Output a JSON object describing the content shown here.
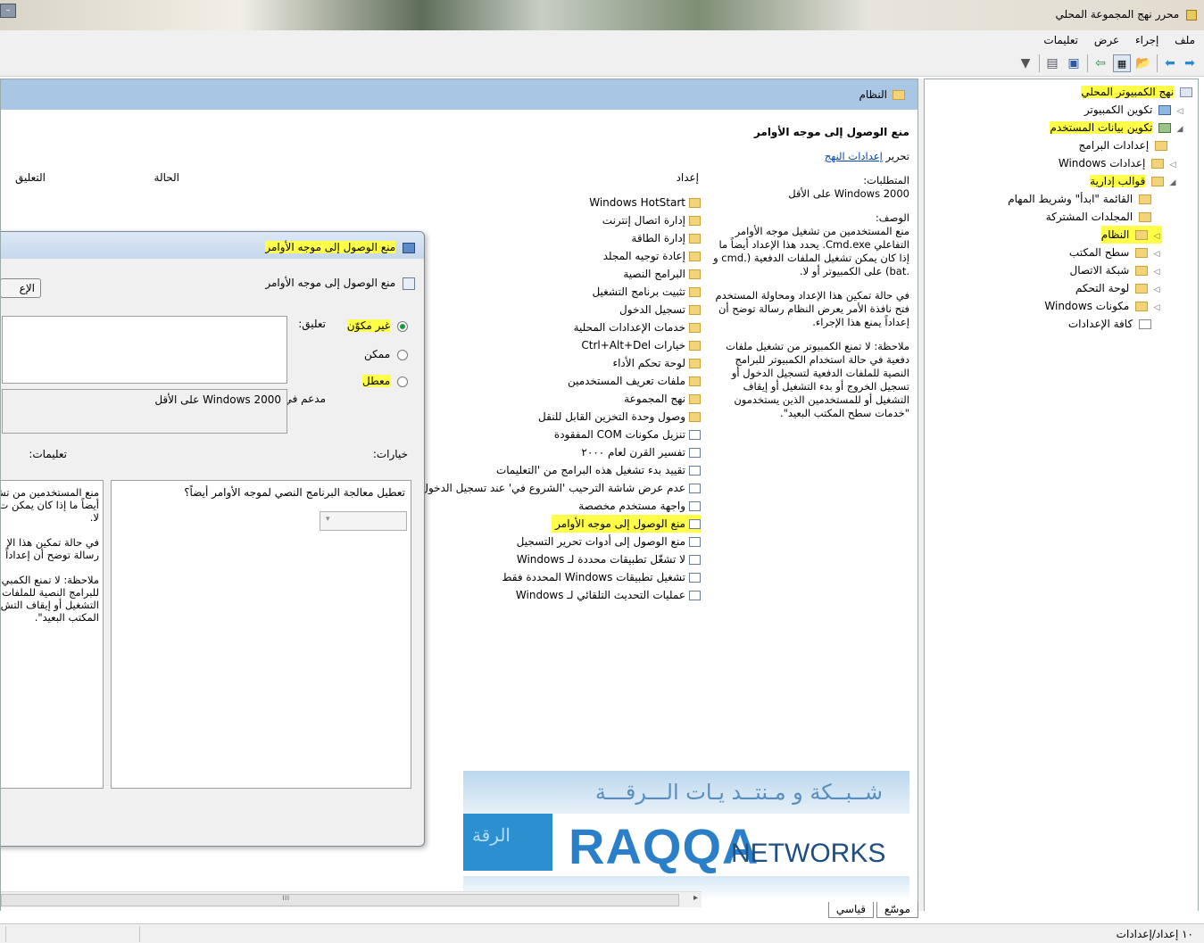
{
  "window": {
    "title": "محرر نهج المجموعة المحلي"
  },
  "menu": [
    "ملف",
    "إجراء",
    "عرض",
    "تعليمات"
  ],
  "tree": [
    {
      "label": "نهج الكمبيوتر المحلي",
      "highlight": true
    },
    {
      "label": "تكوين الكمبيوتر",
      "highlight": false
    },
    {
      "label": "تكوين بيانات المستخدم",
      "highlight": true
    },
    {
      "label": "إعدادات البرامج",
      "highlight": false
    },
    {
      "label": "إعدادات Windows",
      "highlight": false
    },
    {
      "label": "قوالب إدارية",
      "highlight": true
    },
    {
      "label": "القائمة \"ابدأ\" وشريط المهام",
      "highlight": false
    },
    {
      "label": "المجلدات المشتركة",
      "highlight": false
    },
    {
      "label": "النظام",
      "highlight": true
    },
    {
      "label": "سطح المكتب",
      "highlight": false
    },
    {
      "label": "شبكة الاتصال",
      "highlight": false
    },
    {
      "label": "لوحة التحكم",
      "highlight": false
    },
    {
      "label": "مكونات Windows",
      "highlight": false
    },
    {
      "label": "كافة الإعدادات",
      "highlight": false
    }
  ],
  "main": {
    "header_title": "النظام",
    "desc": {
      "title": "منع الوصول إلى موجه الأوامر",
      "edit_prefix": "تحرير",
      "edit_link": "إعدادات النهج",
      "req_label": "المتطلبات:",
      "req_value": "Windows 2000 على الأقل",
      "desc_label": "الوصف:",
      "desc_text": "منع المستخدمين من تشغيل موجه الأوامر التفاعلي Cmd.exe. يحدد هذا الإعداد أيضاً ما إذا كان يمكن تشغيل الملفات الدفعية (.cmd و .bat) على الكمبيوتر أو لا.",
      "p2": "في حالة تمكين هذا الإعداد ومحاولة المستخدم فتح نافذة الأمر يعرض النظام رسالة توضح أن إعداداً يمنع هذا الإجراء.",
      "p3": "ملاحظة: لا تمنع الكمبيوتر من تشغيل ملفات دفعية في حالة استخدام الكمبيوتر للبرامج النصية للملفات الدفعية لتسجيل الدخول أو تسجيل الخروج أو بدء التشغيل أو إيقاف التشغيل أو للمستخدمين الذين يستخدمون \"خدمات سطح المكتب البعيد\"."
    },
    "columns": {
      "setting": "إعداد",
      "state": "الحالة",
      "comment": "التعليق"
    },
    "list": [
      {
        "label": "Windows HotStart",
        "type": "folder",
        "highlight": false
      },
      {
        "label": "إدارة اتصال إنترنت",
        "type": "folder",
        "highlight": false
      },
      {
        "label": "إدارة الطاقة",
        "type": "folder",
        "highlight": false
      },
      {
        "label": "إعادة توجيه المجلد",
        "type": "folder",
        "highlight": false
      },
      {
        "label": "البرامج النصية",
        "type": "folder",
        "highlight": false
      },
      {
        "label": "تثبيت برنامج التشغيل",
        "type": "folder",
        "highlight": false
      },
      {
        "label": "تسجيل الدخول",
        "type": "folder",
        "highlight": false
      },
      {
        "label": "خدمات الإعدادات المحلية",
        "type": "folder",
        "highlight": false
      },
      {
        "label": "خيارات Ctrl+Alt+Del",
        "type": "folder",
        "highlight": false
      },
      {
        "label": "لوحة تحكم الأداء",
        "type": "folder",
        "highlight": false
      },
      {
        "label": "ملفات تعريف المستخدمين",
        "type": "folder",
        "highlight": false
      },
      {
        "label": "نهج المجموعة",
        "type": "folder",
        "highlight": false
      },
      {
        "label": "وصول وحدة التخزين القابل للنقل",
        "type": "folder",
        "highlight": false
      },
      {
        "label": "تنزيل مكونات COM المفقودة",
        "type": "setting",
        "highlight": false
      },
      {
        "label": "تفسير القرن لعام ٢٠٠٠",
        "type": "setting",
        "highlight": false
      },
      {
        "label": "تقييد بدء تشغيل هذه البرامج من 'التعليمات",
        "type": "setting",
        "highlight": false
      },
      {
        "label": "عدم عرض شاشة الترحيب 'الشروع في' عند تسجيل الدخول",
        "type": "setting",
        "highlight": false
      },
      {
        "label": "واجهة مستخدم مخصصة",
        "type": "setting",
        "highlight": false
      },
      {
        "label": "منع الوصول إلى موجه الأوامر",
        "type": "setting",
        "highlight": true
      },
      {
        "label": "منع الوصول إلى أدوات تحرير التسجيل",
        "type": "setting",
        "highlight": false
      },
      {
        "label": "لا تشغّل تطبيقات محددة لـ Windows",
        "type": "setting",
        "highlight": false
      },
      {
        "label": "تشغيل تطبيقات Windows المحددة فقط",
        "type": "setting",
        "highlight": false
      },
      {
        "label": "عمليات التحديث التلقائي لـ Windows",
        "type": "setting",
        "highlight": false
      }
    ],
    "tabs": [
      "موسّع",
      "قياسي"
    ]
  },
  "dialog": {
    "title": "منع الوصول إلى موجه الأوامر",
    "inner_title": "منع الوصول إلى موجه الأوامر",
    "prev_button": "الإع",
    "comment_label": "تعليق:",
    "radio_not_configured": "غير مكوّن",
    "radio_enabled": "ممكن",
    "radio_disabled": "معطل",
    "supported_label": "مدعم في:",
    "supported_value": "Windows 2000 على الأقل",
    "options_label": "خيارات:",
    "help_label": "تعليمات:",
    "option_text": "تعطيل معالجة البرنامج النصي لموجه الأوامر أيضاً؟",
    "help_text_1": "منع المستخدمين من تش",
    "help_text_2": "أيضاً ما إذا كان يمكن ت",
    "help_text_3": "لا.",
    "help_text_4": "في حالة تمكين هذا الإ",
    "help_text_5": "رسالة توضح أن إعداداً",
    "help_text_6": "ملاحظة: لا تمنع الكمبي",
    "help_text_7": "للبرامج النصية للملفات",
    "help_text_8": "التشغيل أو إيقاف التش",
    "help_text_9": "المكتب البعيد\"."
  },
  "watermark": {
    "arabic": "شــبــكة و مـنتــد يـات الـــرقـــة",
    "left_arabic": "الرقة",
    "brand1": "RAQQA",
    "brand2": "NETWORKS"
  },
  "status": {
    "text": "١٠ إعداد/إعدادات"
  }
}
